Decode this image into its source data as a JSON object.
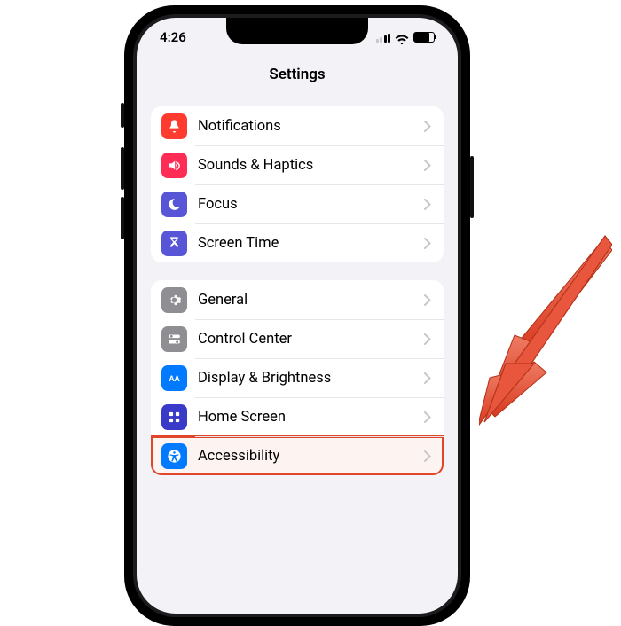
{
  "status": {
    "time": "4:26"
  },
  "nav": {
    "title": "Settings"
  },
  "groups": [
    {
      "rows": [
        {
          "key": "notifications",
          "label": "Notifications",
          "icon": "bell",
          "color": "#ff3b30"
        },
        {
          "key": "sounds",
          "label": "Sounds & Haptics",
          "icon": "speaker",
          "color": "#ff2d55"
        },
        {
          "key": "focus",
          "label": "Focus",
          "icon": "moon",
          "color": "#5856d6"
        },
        {
          "key": "screentime",
          "label": "Screen Time",
          "icon": "hourglass",
          "color": "#5856d6"
        }
      ]
    },
    {
      "rows": [
        {
          "key": "general",
          "label": "General",
          "icon": "gear",
          "color": "#8e8e93"
        },
        {
          "key": "controlcenter",
          "label": "Control Center",
          "icon": "switches",
          "color": "#8e8e93"
        },
        {
          "key": "display",
          "label": "Display & Brightness",
          "icon": "aa",
          "color": "#007aff"
        },
        {
          "key": "homescreen",
          "label": "Home Screen",
          "icon": "grid",
          "color": "#3a3ac8"
        },
        {
          "key": "accessibility",
          "label": "Accessibility",
          "icon": "access",
          "color": "#007aff",
          "highlight": true
        }
      ]
    }
  ],
  "annotation": {
    "arrow_color": "#e1452a"
  }
}
